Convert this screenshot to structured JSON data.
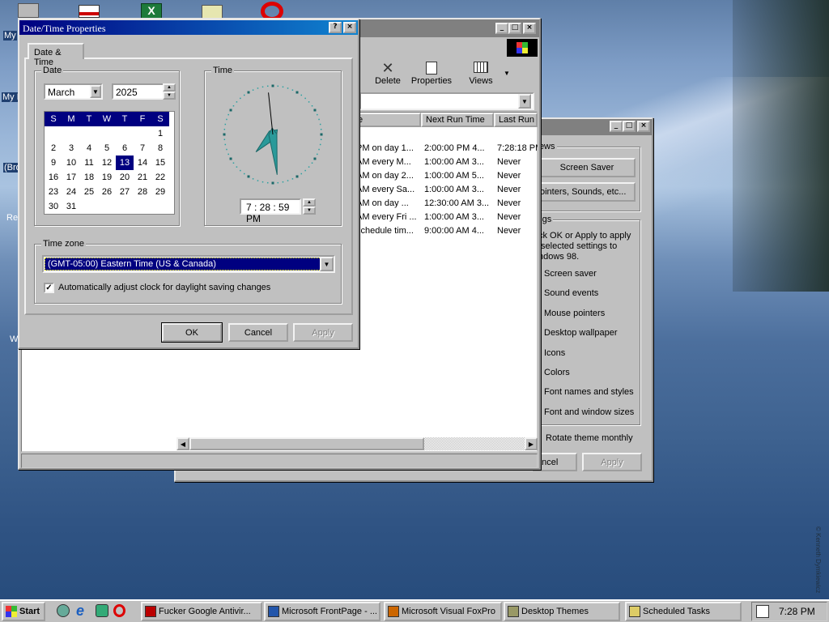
{
  "desktop": {
    "icon_labels": [
      "My",
      "My D",
      "(Bro",
      "Re",
      "W"
    ],
    "watermark": "© Kenneth Dymkiewicz"
  },
  "scheduled_tasks": {
    "toolbar": {
      "delete_label": "Delete",
      "properties_label": "Properties",
      "views_label": "Views"
    },
    "columns": [
      "e",
      "Next Run Time",
      "Last Run"
    ],
    "rows": [
      [
        "PM on day 1...",
        "2:00:00 PM  4...",
        "7:28:18 PM"
      ],
      [
        "AM every M...",
        "1:00:00 AM  3...",
        "Never"
      ],
      [
        "AM on day 2...",
        "1:00:00 AM  5...",
        "Never"
      ],
      [
        "AM every Sa...",
        "1:00:00 AM  3...",
        "Never"
      ],
      [
        " AM on day ...",
        "12:30:00 AM  3...",
        "Never"
      ],
      [
        "AM every Fri ...",
        "1:00:00 AM  3...",
        "Never"
      ],
      [
        "schedule tim...",
        "9:00:00 AM  4...",
        "Never"
      ]
    ]
  },
  "desktop_themes": {
    "previews_label": "views",
    "screen_saver_button": "Screen Saver",
    "pointers_button": "ointers, Sounds, etc...",
    "settings_label": "tings",
    "settings_desc": "ck OK or Apply to apply\n selected settings to\nndows 98.",
    "items": [
      "Screen saver",
      "Sound events",
      "Mouse pointers",
      "Desktop wallpaper",
      "Icons",
      "Colors",
      "Font names and styles",
      "Font and window sizes"
    ],
    "rotate_label": "Rotate theme monthly",
    "cancel_label": "ancel",
    "apply_label": "Apply"
  },
  "datetime": {
    "title": "Date/Time Properties",
    "tab": "Date & Time",
    "date_group": "Date",
    "time_group": "Time",
    "month": "March",
    "year": "2025",
    "weekdays": [
      "S",
      "M",
      "T",
      "W",
      "T",
      "F",
      "S"
    ],
    "weeks": [
      [
        "",
        "",
        "",
        "",
        "",
        "",
        "1"
      ],
      [
        "2",
        "3",
        "4",
        "5",
        "6",
        "7",
        "8"
      ],
      [
        "9",
        "10",
        "11",
        "12",
        "13",
        "14",
        "15"
      ],
      [
        "16",
        "17",
        "18",
        "19",
        "20",
        "21",
        "22"
      ],
      [
        "23",
        "24",
        "25",
        "26",
        "27",
        "28",
        "29"
      ],
      [
        "30",
        "31",
        "",
        "",
        "",
        "",
        ""
      ]
    ],
    "selected_day": "13",
    "time": "7 : 28 : 59 PM",
    "clock_hour": 7,
    "clock_minute": 28,
    "clock_second": 59,
    "timezone_group": "Time zone",
    "timezone": "(GMT-05:00) Eastern Time (US & Canada)",
    "dst_label": "Automatically adjust clock for daylight saving changes",
    "dst_checked": true,
    "ok": "OK",
    "cancel": "Cancel",
    "apply": "Apply"
  },
  "taskbar": {
    "start": "Start",
    "tasks": [
      {
        "label": "Fucker Google Antivir...",
        "icon": "fg-app-icon",
        "pressed": false
      },
      {
        "label": "Microsoft FrontPage - ...",
        "icon": "frontpage-icon",
        "pressed": false
      },
      {
        "label": "Microsoft Visual FoxPro",
        "icon": "foxpro-icon",
        "pressed": false
      },
      {
        "label": "Desktop Themes",
        "icon": "themes-icon",
        "pressed": false
      },
      {
        "label": "Scheduled Tasks",
        "icon": "folder-icon",
        "pressed": false
      }
    ],
    "clock": "7:28 PM"
  }
}
